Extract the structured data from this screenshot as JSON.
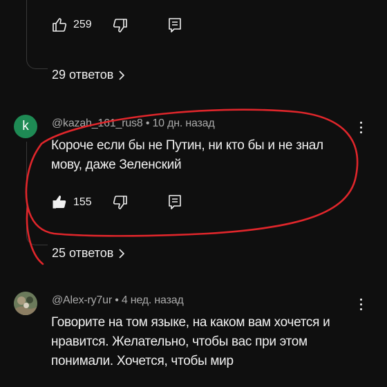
{
  "top_comment": {
    "like_count": "259",
    "replies": "29 ответов"
  },
  "comment_kazah": {
    "avatar_letter": "k",
    "author": "@kazah_161_rus8",
    "separator": "•",
    "time": "10 дн. назад",
    "text": "Короче если бы не Путин, ни кто бы и не знал мову, даже Зеленский",
    "like_count": "155",
    "replies": "25 ответов"
  },
  "comment_alex": {
    "author": "@Alex-ry7ur",
    "separator": "•",
    "time": "4 нед. назад",
    "text": "Говорите на том языке, на каком вам хочется и нравится. Желательно, чтобы вас при этом понимали. Хочется, чтобы мир"
  },
  "colors": {
    "background": "#0f0f0f",
    "avatar_green": "#1e8a54",
    "annotation_red": "#e0262b",
    "meta_gray": "#aaaaaa"
  },
  "icons": [
    "like-icon",
    "like-filled-icon",
    "dislike-icon",
    "reply-icon",
    "chevron-right-icon",
    "more-vert-icon"
  ]
}
